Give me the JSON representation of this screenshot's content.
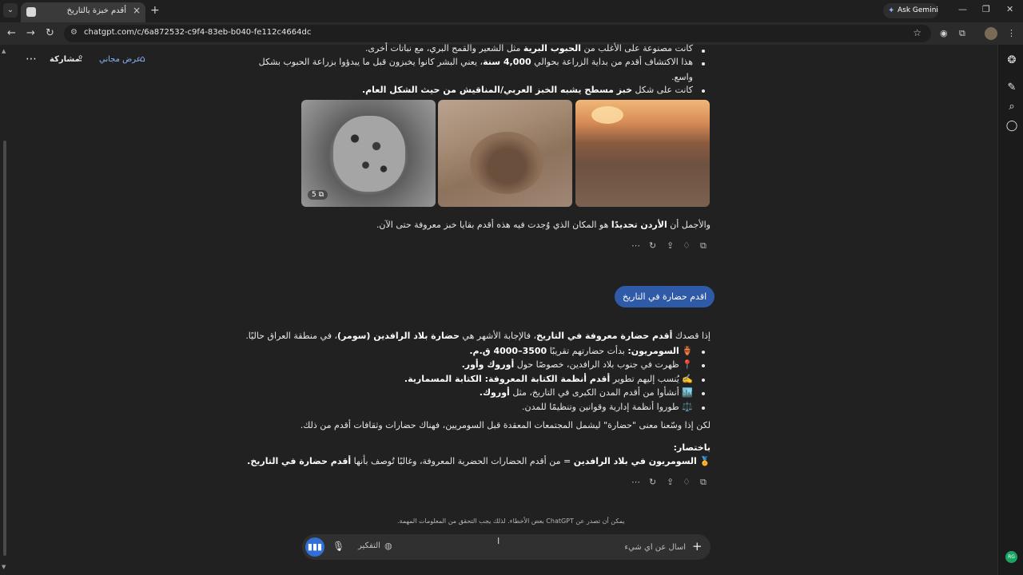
{
  "browser": {
    "tab_title": "أقدم خبزة بالتاريخ",
    "url": "chatgpt.com/c/6a872532-c9f4-83eb-b040-fe112c4664dc",
    "ask_gemini": "Ask Gemini"
  },
  "header": {
    "share_label": "مشاركة",
    "free_offer_label": "عرض مجاني"
  },
  "previous_answer": {
    "lines": [
      [
        "كانت مصنوعة على الأغلب من ",
        "الحبوب البرية",
        " مثل الشعير والقمح البري، مع نباتات أخرى."
      ],
      [
        "هذا الاكتشاف أقدم من بداية الزراعة بحوالي ",
        "4,000 سنة",
        "، يعني البشر كانوا يخبزون قبل ما يبدؤوا بزراعة الحبوب بشكل"
      ],
      [
        "واسع.",
        "",
        ""
      ],
      [
        "كانت على شكل ",
        "خبز مسطح يشبه الخبز العربي/المناقيش من حيث الشكل العام.",
        ""
      ]
    ],
    "image_count": "5",
    "closing": [
      "والأجمل أن ",
      "الأردن تحديدًا",
      " هو المكان الذي وُجدت فيه هذه أقدم بقايا خبز معروفة حتى الآن."
    ]
  },
  "user_message": "اقدم حضارة في التاريخ",
  "answer": {
    "intro": [
      "إذا قصدك ",
      "أقدم حضارة معروفة في التاريخ",
      "، فالإجابة الأشهر هي ",
      "حضارة بلاد الرافدين (سومر)",
      "، في منطقة العراق حاليًا."
    ],
    "bullets": [
      [
        "🏺 ",
        "السومريون:",
        " بدأت حضارتهم تقريبًا ",
        "3500–4000 ق.م."
      ],
      [
        "📍 ",
        "",
        "ظهرت في جنوب بلاد الرافدين، خصوصًا حول ",
        "أوروك وأور."
      ],
      [
        "✍️ ",
        "",
        "يُنسب إليهم تطوير ",
        "أقدم أنظمة الكتابة المعروفة: الكتابة المسمارية."
      ],
      [
        "🏙️ ",
        "",
        "أنشأوا من أقدم المدن الكبرى في التاريخ، مثل ",
        "أوروك."
      ],
      [
        "⚖️ ",
        "",
        "طوروا أنظمة إدارية وقوانين وتنظيمًا للمدن.",
        ""
      ]
    ],
    "note": "لكن إذا وسّعنا معنى \"حضارة\" ليشمل المجتمعات المعقدة قبل السومريين، فهناك حضارات وثقافات أقدم من ذلك.",
    "summary_title": "باختصار:",
    "summary": [
      "🏅 ",
      "السومريون في بلاد الرافدين",
      " = من أقدم الحضارات الحضرية المعروفة، وغالبًا تُوصف بأنها ",
      "أقدم حضارة في التاريخ."
    ]
  },
  "disclaimer": "يمكن أن تصدر عن ChatGPT بعض الأخطاء. لذلك يجب التحقق من المعلومات المهمة.",
  "composer": {
    "placeholder": "اسأل عن أي شيء",
    "think_label": "التفكير"
  },
  "avatar_initials": "RG"
}
